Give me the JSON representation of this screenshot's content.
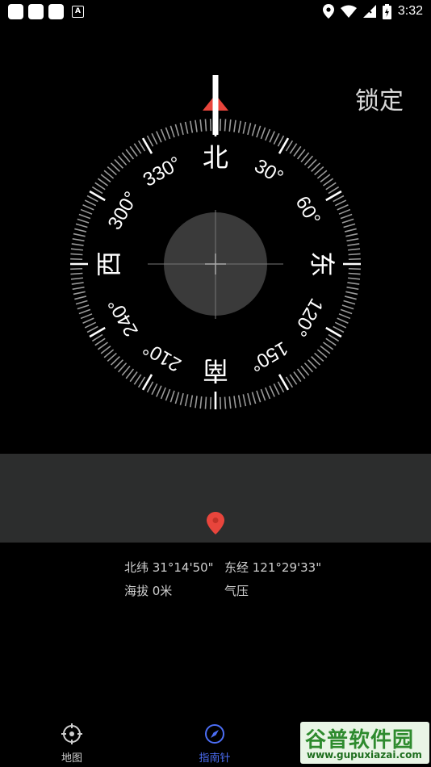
{
  "status_bar": {
    "time": "3:32",
    "notification_badge": "A",
    "icons": [
      "location-icon",
      "wifi-icon",
      "no-signal-icon",
      "battery-icon"
    ]
  },
  "compass": {
    "lock_label": "锁定",
    "cardinals": {
      "north": "北",
      "east": "东",
      "south": "南",
      "west": "西"
    },
    "degree_labels": [
      "30°",
      "60°",
      "120°",
      "150°",
      "210°",
      "240°",
      "300°",
      "330°"
    ],
    "colors": {
      "north_arrow": "#e8453c",
      "ring": "#ffffff",
      "center_disc": "#3a3a3a"
    }
  },
  "location": {
    "latitude": "北纬 31°14'50\"",
    "longitude": "东经 121°29'33\"",
    "altitude": "海拔 0米",
    "pressure": "气压",
    "pin_color": "#e8453c"
  },
  "bottom_nav": {
    "items": [
      {
        "label": "地图",
        "icon": "crosshair-icon",
        "active": false
      },
      {
        "label": "指南针",
        "icon": "compass-icon",
        "active": true
      }
    ],
    "active_color": "#4c6ef5"
  },
  "watermark": {
    "title": "谷普软件园",
    "url": "www.gupuxiazai.com"
  }
}
